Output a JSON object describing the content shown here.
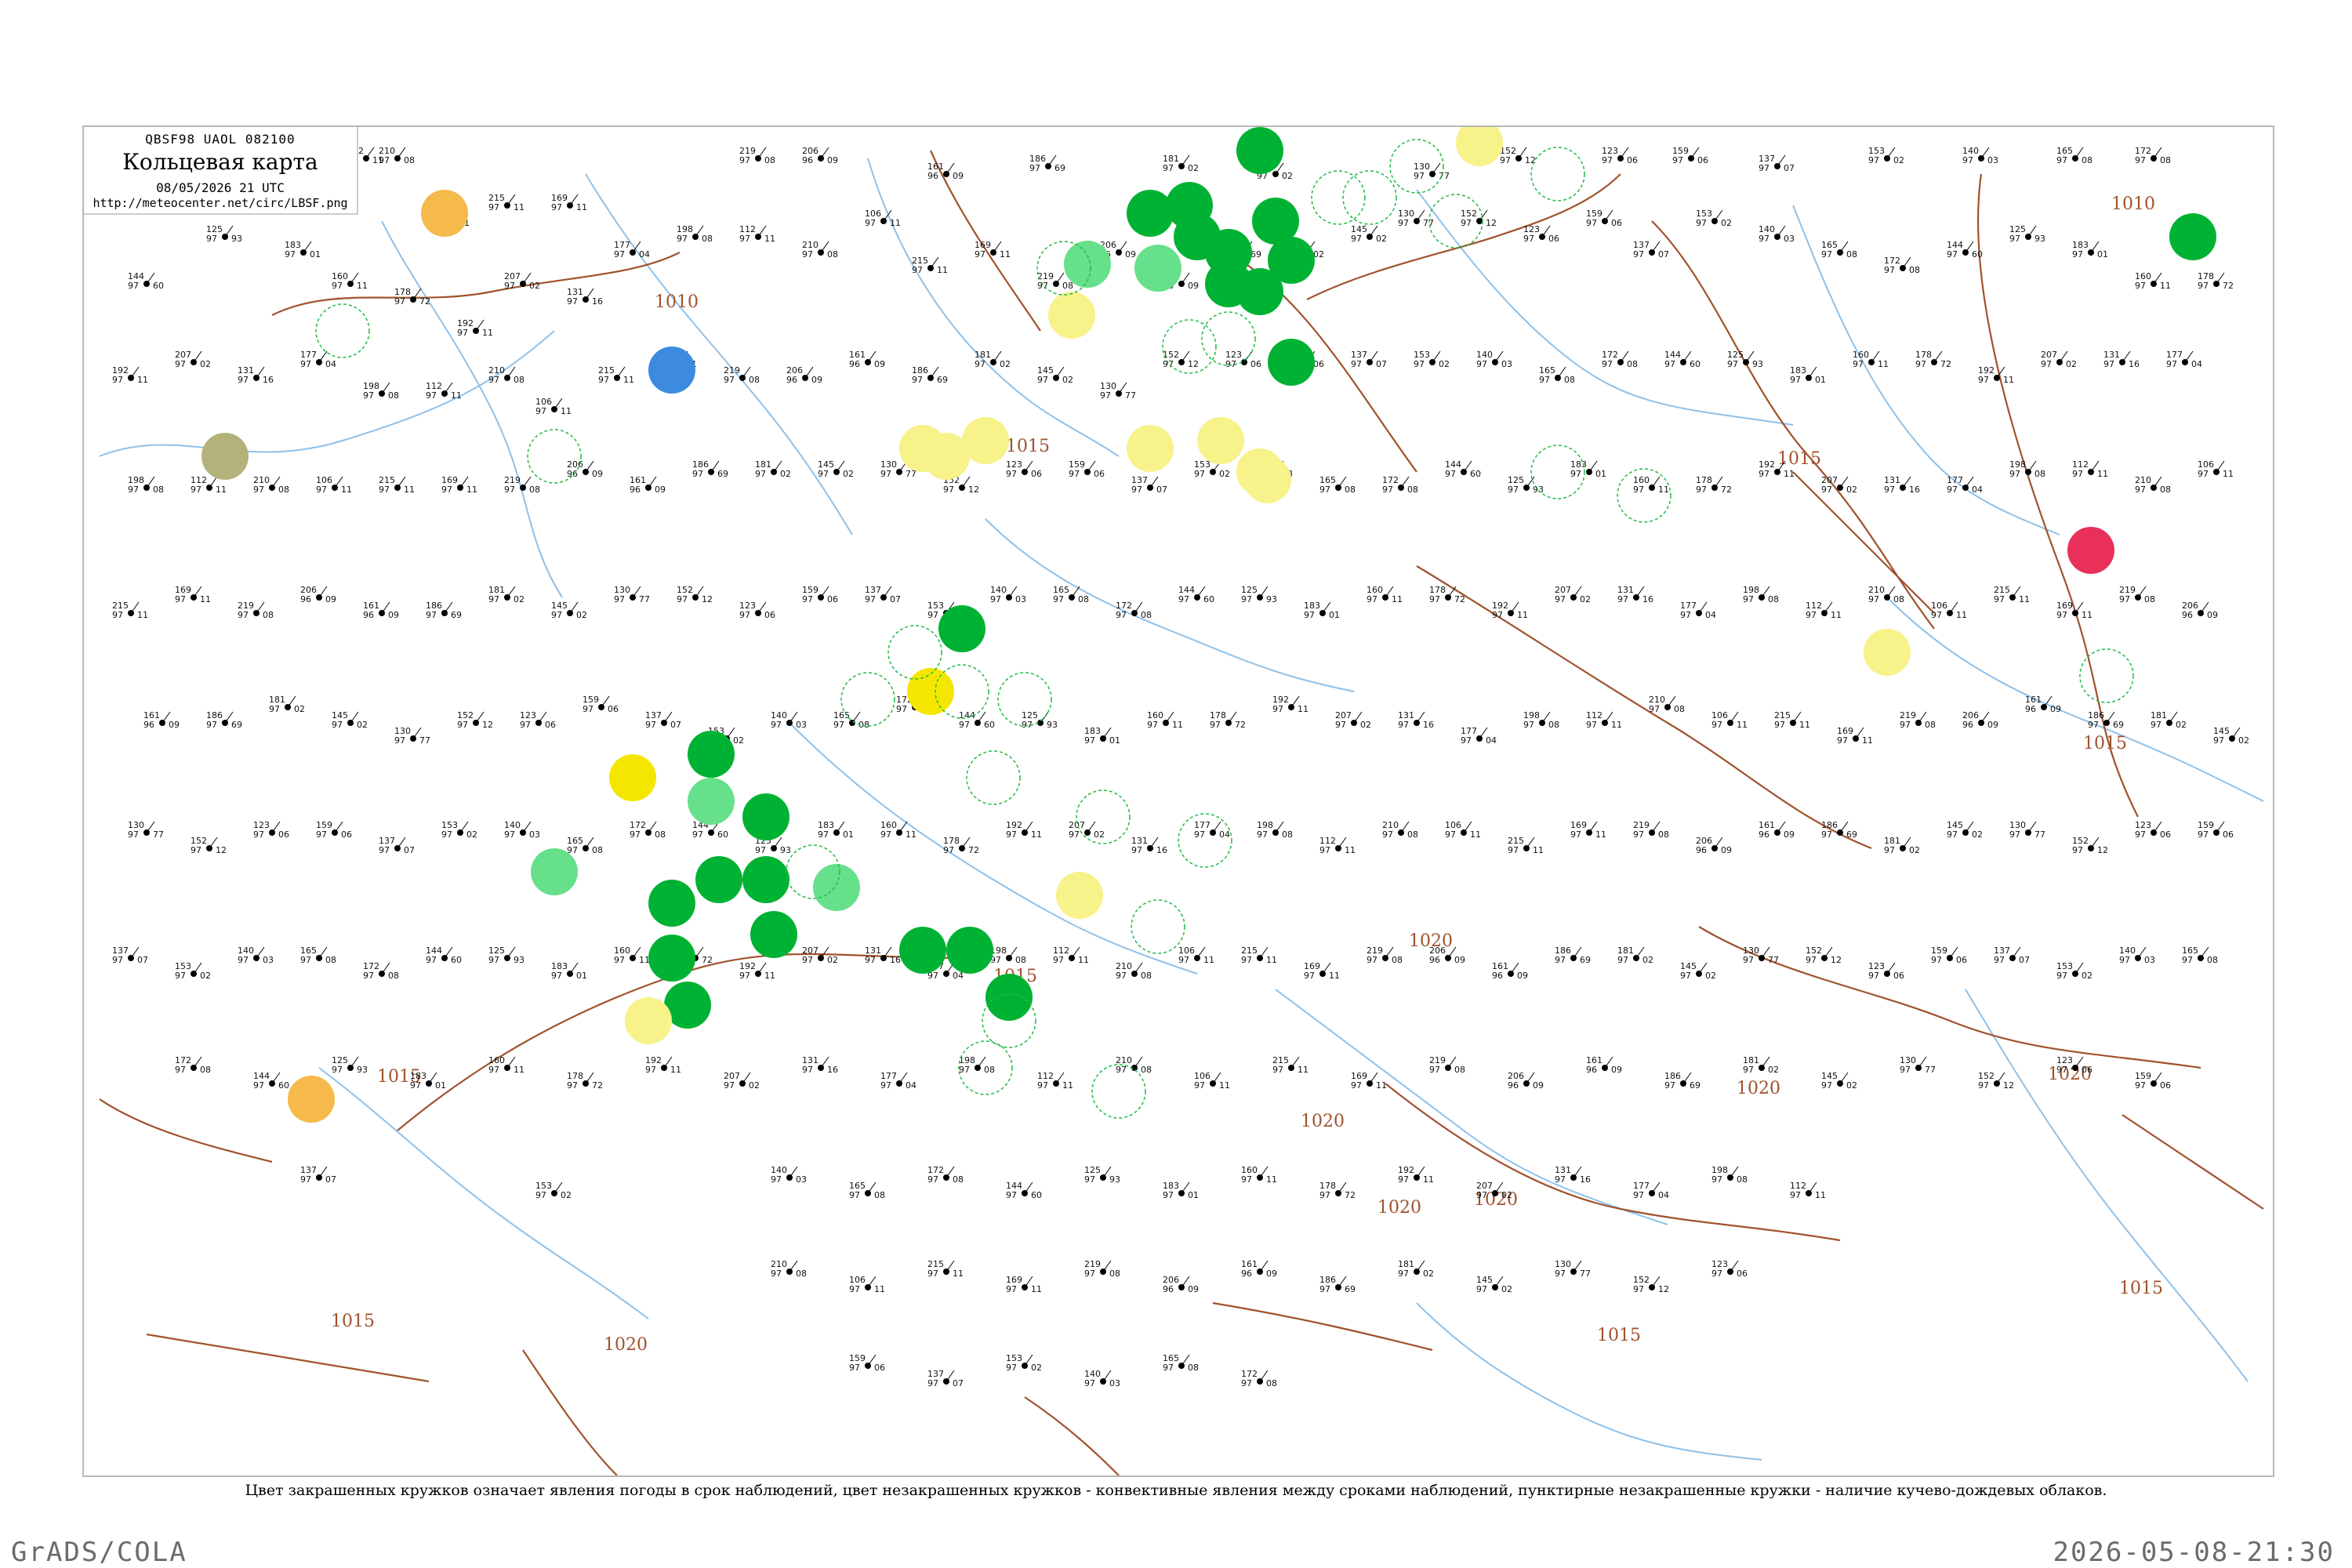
{
  "header": {
    "code": "QBSF98  UAOL  082100",
    "title": "Кольцевая карта",
    "datetime": "08/05/2026 21 UTC",
    "url": "http://meteocenter.net/circ/LBSF.png"
  },
  "caption": "Цвет закрашенных кружков означает явления погоды в срок наблюдений, цвет незакрашенных кружков - конвективные явления между сроками наблюдений, пунктирные незакрашенные кружки - наличие кучево-дождевых облаков.",
  "footer": {
    "left": "GrADS/COLA",
    "right": "2026-05-08-21:30"
  },
  "colors": {
    "isobar": "#a0522d",
    "water": "#8ec1ea",
    "rain_green": "#00b233",
    "light_green": "#66e08a",
    "yellow": "#f7f28a",
    "bright_yellow": "#f5e600",
    "orange": "#f6b94b",
    "blue": "#3c8be0",
    "olive": "#b2b27a",
    "red": "#e8305a",
    "convective_ring": "#22bb44"
  },
  "isobar_labels": [
    "1010",
    "1010",
    "1015",
    "1015",
    "1015",
    "1015",
    "1015",
    "1015",
    "1015",
    "1015",
    "1020",
    "1020",
    "1020",
    "1020",
    "1020",
    "1020",
    "1020"
  ],
  "stations": [
    {
      "p": "112",
      "t": "97",
      "d": "11"
    },
    {
      "p": "210",
      "t": "97",
      "d": "08"
    },
    {
      "p": "106",
      "t": "97",
      "d": "11"
    },
    {
      "p": "215",
      "t": "97",
      "d": "11"
    },
    {
      "p": "169",
      "t": "97",
      "d": "11"
    },
    {
      "p": "219",
      "t": "97",
      "d": "08"
    },
    {
      "p": "206",
      "t": "96",
      "d": "09"
    },
    {
      "p": "161",
      "t": "96",
      "d": "09"
    },
    {
      "p": "186",
      "t": "97",
      "d": "69"
    },
    {
      "p": "181",
      "t": "97",
      "d": "02"
    },
    {
      "p": "145",
      "t": "97",
      "d": "02"
    },
    {
      "p": "130",
      "t": "97",
      "d": "77"
    },
    {
      "p": "152",
      "t": "97",
      "d": "12"
    },
    {
      "p": "123",
      "t": "97",
      "d": "06"
    },
    {
      "p": "159",
      "t": "97",
      "d": "06"
    },
    {
      "p": "137",
      "t": "97",
      "d": "07"
    },
    {
      "p": "153",
      "t": "97",
      "d": "02"
    },
    {
      "p": "140",
      "t": "97",
      "d": "03"
    },
    {
      "p": "165",
      "t": "97",
      "d": "08"
    },
    {
      "p": "172",
      "t": "97",
      "d": "08"
    },
    {
      "p": "144",
      "t": "97",
      "d": "60"
    },
    {
      "p": "125",
      "t": "97",
      "d": "93"
    },
    {
      "p": "183",
      "t": "97",
      "d": "01"
    },
    {
      "p": "160",
      "t": "97",
      "d": "11"
    },
    {
      "p": "178",
      "t": "97",
      "d": "72"
    },
    {
      "p": "192",
      "t": "97",
      "d": "11"
    },
    {
      "p": "207",
      "t": "97",
      "d": "02"
    },
    {
      "p": "131",
      "t": "97",
      "d": "16"
    },
    {
      "p": "177",
      "t": "97",
      "d": "04"
    },
    {
      "p": "198",
      "t": "97",
      "d": "08"
    }
  ]
}
